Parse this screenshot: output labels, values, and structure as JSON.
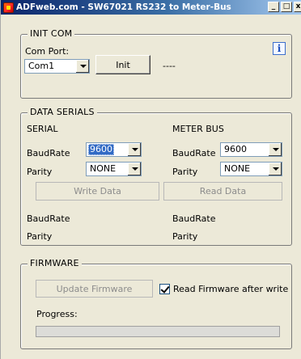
{
  "window": {
    "title": "ADFweb.com - SW67021 RS232 to Meter-Bus",
    "minimize_label": "_",
    "maximize_label": "□",
    "close_label": "x"
  },
  "init_com": {
    "legend": "INIT COM",
    "com_port_label": "Com Port:",
    "com_port_value": "Com1",
    "init_button": "Init",
    "status": "----",
    "info_icon_glyph": "i"
  },
  "data_serials": {
    "legend": "DATA SERIALS",
    "serial_header": "SERIAL",
    "meter_header": "METER BUS",
    "baudrate_label": "BaudRate",
    "parity_label": "Parity",
    "serial_baudrate": "9600",
    "serial_parity": "NONE",
    "meter_baudrate": "9600",
    "meter_parity": "NONE",
    "write_button": "Write Data",
    "read_button": "Read Data",
    "read_baudrate_serial": "BaudRate",
    "read_parity_serial": "Parity",
    "read_baudrate_meter": "BaudRate",
    "read_parity_meter": "Parity"
  },
  "firmware": {
    "legend": "FIRMWARE",
    "update_button": "Update Firmware",
    "read_after_write_label": "Read Firmware after write",
    "read_after_write_checked": true,
    "progress_label": "Progress:",
    "progress_fraction": 0
  }
}
